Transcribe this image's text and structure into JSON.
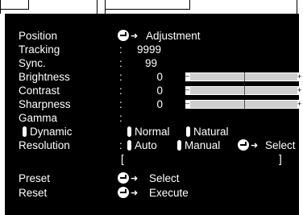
{
  "menu": {
    "header": {
      "label": "Position",
      "action": "Adjustment"
    },
    "rows": [
      {
        "label": "Tracking",
        "colon": ":",
        "value": "9999"
      },
      {
        "label": "Sync.",
        "colon": ":",
        "value": "99"
      },
      {
        "label": "Brightness",
        "colon": ":",
        "value": "0",
        "slider_level": 0.5
      },
      {
        "label": "Contrast",
        "colon": ":",
        "value": "0",
        "slider_level": 0.5
      },
      {
        "label": "Sharpness",
        "colon": ":",
        "value": "0",
        "slider_level": 0.5
      },
      {
        "label": "Gamma",
        "colon": ":"
      }
    ],
    "gamma_options": [
      "Dynamic",
      "Normal",
      "Natural"
    ],
    "resolution": {
      "label": "Resolution",
      "colon": ":",
      "options": [
        "Auto",
        "Manual"
      ],
      "select_label": "Select",
      "bracket_open": "[",
      "bracket_close": "]"
    },
    "preset": {
      "label": "Preset",
      "action": "Select"
    },
    "reset": {
      "label": "Reset",
      "action": "Execute"
    }
  },
  "icons": {
    "enter": "enter-button-icon",
    "arrow": "arrow-right-icon",
    "radio": "radio-indicator-icon"
  }
}
